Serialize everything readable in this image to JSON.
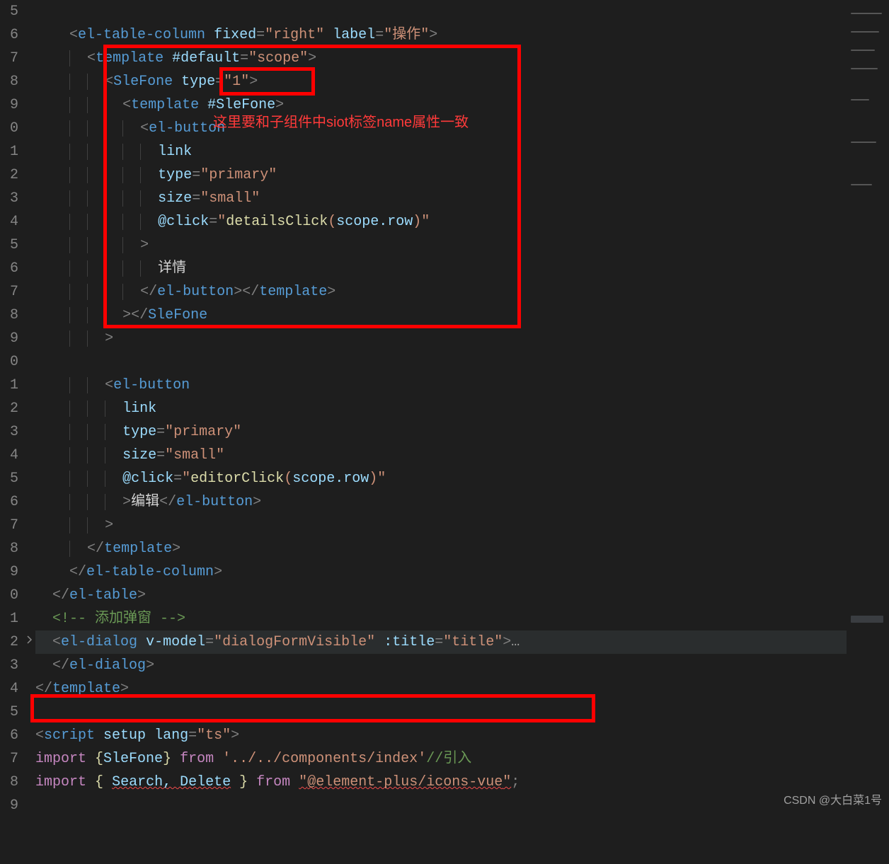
{
  "gutter_start_ones": 5,
  "gutter_lines": 35,
  "chevron_line_index": 26,
  "highlight_line_index": 26,
  "red_annotation": "这里要和子组件中siot标签name属性一致",
  "watermark": "CSDN @大白菜1号",
  "code": {
    "l0": {
      "tag": "el-table-column",
      "a1": "fixed",
      "v1": "right",
      "a2": "label",
      "v2": "操作"
    },
    "l1": {
      "tag": "template",
      "a1": "#default",
      "v1": "scope"
    },
    "l2": {
      "tag": "SleFone",
      "a1": "type",
      "v1": "1"
    },
    "l3": {
      "tag": "template",
      "a1": "#SleFone"
    },
    "l4": {
      "tag": "el-button"
    },
    "l5": {
      "attr": "link"
    },
    "l6": {
      "attr": "type",
      "val": "primary"
    },
    "l7": {
      "attr": "size",
      "val": "small"
    },
    "l8": {
      "attr": "@click",
      "val": "detailsClick",
      "arg": "scope.row"
    },
    "l9": {
      "punct": ">"
    },
    "l10": {
      "text": "详情"
    },
    "l11": {
      "close1": "el-button",
      "close2": "template"
    },
    "l12": {
      "endself": ">",
      "close": "SleFone"
    },
    "l13": {
      "punct": ">"
    },
    "l15": {
      "tag": "el-button"
    },
    "l16": {
      "attr": "link"
    },
    "l17": {
      "attr": "type",
      "val": "primary"
    },
    "l18": {
      "attr": "size",
      "val": "small"
    },
    "l19": {
      "attr": "@click",
      "val": "editorClick",
      "arg": "scope.row"
    },
    "l20": {
      "punct": ">",
      "text": "编辑",
      "close": "el-button"
    },
    "l21": {
      "punct": ">"
    },
    "l22": {
      "close": "template"
    },
    "l23": {
      "close": "el-table-column"
    },
    "l24": {
      "close": "el-table"
    },
    "l25": {
      "comment": "添加弹窗"
    },
    "l26": {
      "tag": "el-dialog",
      "a1": "v-model",
      "v1": "dialogFormVisible",
      "a2": ":title",
      "v2": "title"
    },
    "l27": {
      "close": "el-dialog"
    },
    "l28": {
      "close": "template"
    },
    "l30": {
      "tag": "script",
      "a1": "setup",
      "a2": "lang",
      "v2": "ts"
    },
    "l31": {
      "kw": "import",
      "brace": "{",
      "name": "SleFone",
      "brace2": "}",
      "kw2": "from",
      "path": "../../components/index",
      "cmt": "//引入"
    },
    "l32": {
      "kw": "import",
      "names": "Search, Delete",
      "kw2": "from",
      "path": "@element-plus/icons-vue"
    }
  }
}
